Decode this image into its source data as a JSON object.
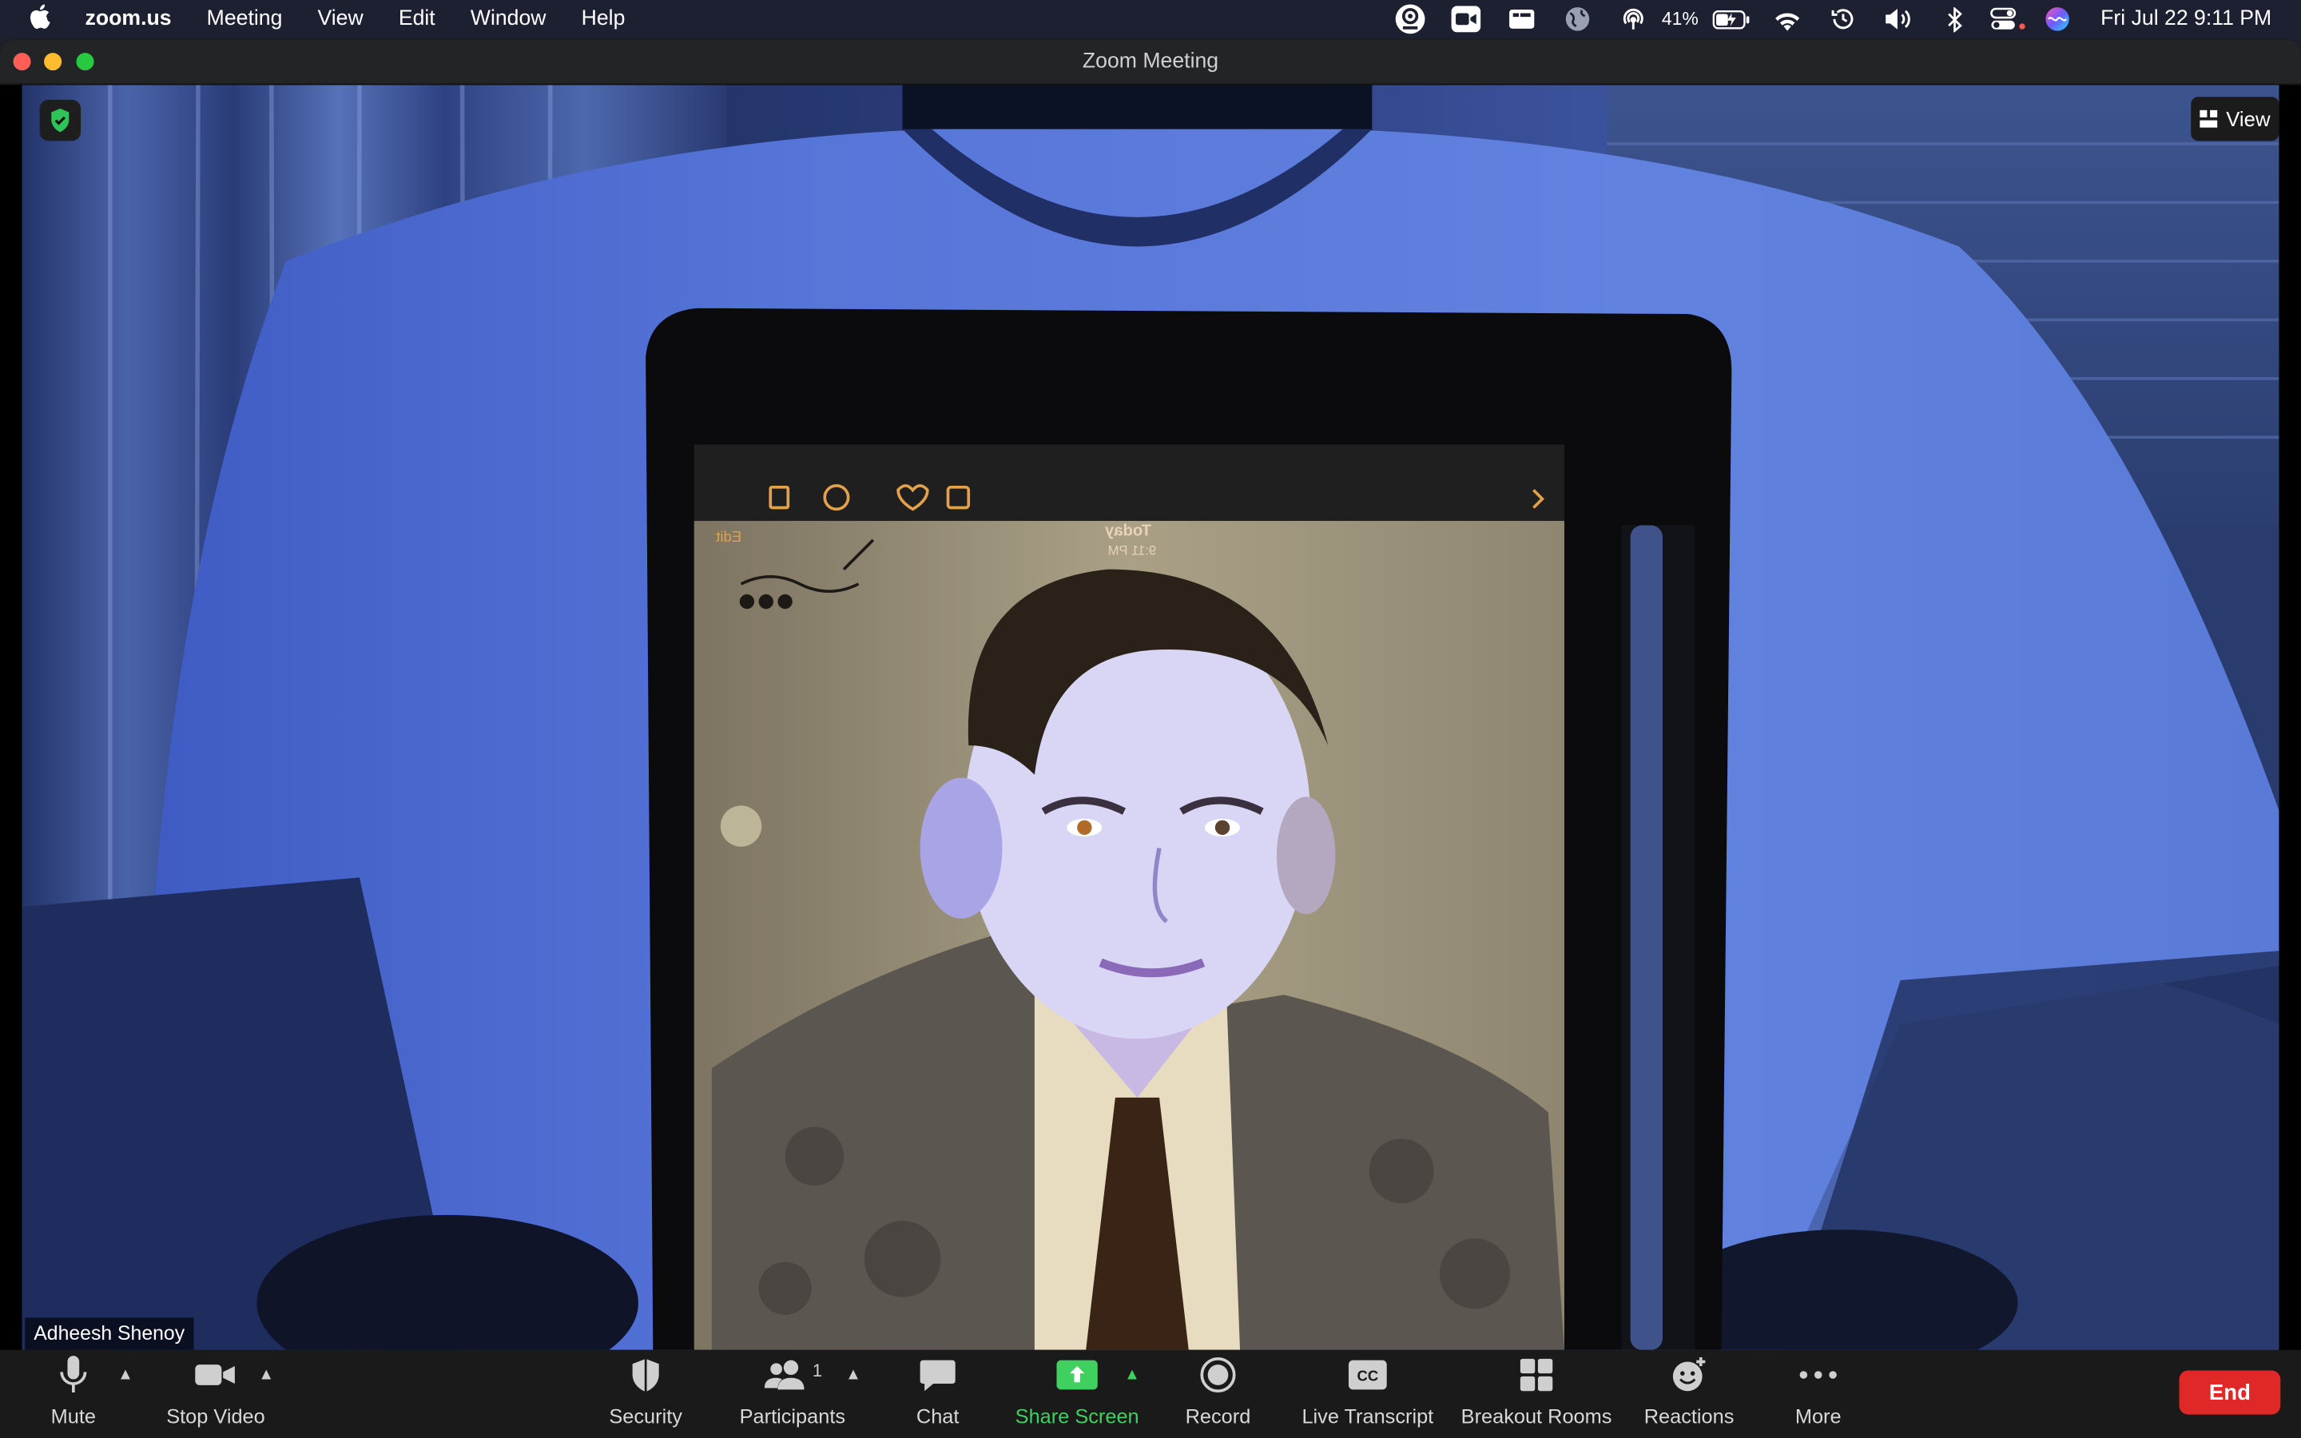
{
  "menubar": {
    "app_name": "zoom.us",
    "menus": [
      "Meeting",
      "View",
      "Edit",
      "Window",
      "Help"
    ],
    "battery": "41%",
    "clock": "Fri Jul 22  9:11 PM"
  },
  "window": {
    "title": "Zoom Meeting"
  },
  "video": {
    "view_label": "View",
    "participant_name": "Adheesh Shenoy",
    "ipad_screen": {
      "date_label": "Today",
      "time_label": "9:11 PM",
      "edit_label": "Edit"
    }
  },
  "controls": {
    "mute": "Mute",
    "stop_video": "Stop Video",
    "security": "Security",
    "participants": "Participants",
    "participants_count": "1",
    "chat": "Chat",
    "share_screen": "Share Screen",
    "record": "Record",
    "live_transcript": "Live Transcript",
    "breakout_rooms": "Breakout Rooms",
    "reactions": "Reactions",
    "more": "More",
    "end": "End"
  },
  "colors": {
    "share_green": "#3fd05f",
    "end_red": "#e02828",
    "security_shield_green": "#2ec45a"
  }
}
